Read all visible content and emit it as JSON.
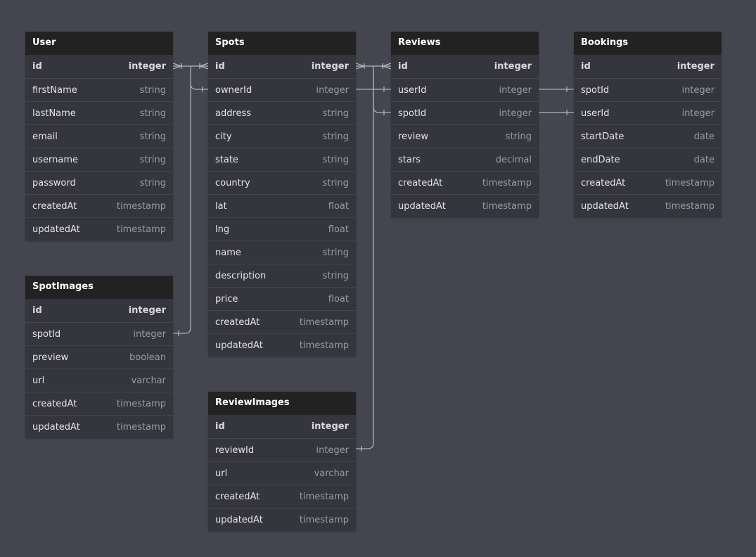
{
  "tables": [
    {
      "name": "User",
      "fields": [
        {
          "name": "id",
          "type": "integer",
          "pk": true
        },
        {
          "name": "firstName",
          "type": "string"
        },
        {
          "name": "lastName",
          "type": "string"
        },
        {
          "name": "email",
          "type": "string"
        },
        {
          "name": "username",
          "type": "string"
        },
        {
          "name": "password",
          "type": "string"
        },
        {
          "name": "createdAt",
          "type": "timestamp"
        },
        {
          "name": "updatedAt",
          "type": "timestamp"
        }
      ]
    },
    {
      "name": "Spots",
      "fields": [
        {
          "name": "id",
          "type": "integer",
          "pk": true
        },
        {
          "name": "ownerId",
          "type": "integer"
        },
        {
          "name": "address",
          "type": "string"
        },
        {
          "name": "city",
          "type": "string"
        },
        {
          "name": "state",
          "type": "string"
        },
        {
          "name": "country",
          "type": "string"
        },
        {
          "name": "lat",
          "type": "float"
        },
        {
          "name": "lng",
          "type": "float"
        },
        {
          "name": "name",
          "type": "string"
        },
        {
          "name": "description",
          "type": "string"
        },
        {
          "name": "price",
          "type": "float"
        },
        {
          "name": "createdAt",
          "type": "timestamp"
        },
        {
          "name": "updatedAt",
          "type": "timestamp"
        }
      ]
    },
    {
      "name": "Reviews",
      "fields": [
        {
          "name": "id",
          "type": "integer",
          "pk": true
        },
        {
          "name": "userId",
          "type": "integer"
        },
        {
          "name": "spotId",
          "type": "integer"
        },
        {
          "name": "review",
          "type": "string"
        },
        {
          "name": "stars",
          "type": "decimal"
        },
        {
          "name": "createdAt",
          "type": "timestamp"
        },
        {
          "name": "updatedAt",
          "type": "timestamp"
        }
      ]
    },
    {
      "name": "Bookings",
      "fields": [
        {
          "name": "id",
          "type": "integer",
          "pk": true
        },
        {
          "name": "spotId",
          "type": "integer"
        },
        {
          "name": "userId",
          "type": "integer"
        },
        {
          "name": "startDate",
          "type": "date"
        },
        {
          "name": "endDate",
          "type": "date"
        },
        {
          "name": "createdAt",
          "type": "timestamp"
        },
        {
          "name": "updatedAt",
          "type": "timestamp"
        }
      ]
    },
    {
      "name": "SpotImages",
      "fields": [
        {
          "name": "id",
          "type": "integer",
          "pk": true
        },
        {
          "name": "spotId",
          "type": "integer"
        },
        {
          "name": "preview",
          "type": "boolean"
        },
        {
          "name": "url",
          "type": "varchar"
        },
        {
          "name": "createdAt",
          "type": "timestamp"
        },
        {
          "name": "updatedAt",
          "type": "timestamp"
        }
      ]
    },
    {
      "name": "ReviewImages",
      "fields": [
        {
          "name": "id",
          "type": "integer",
          "pk": true
        },
        {
          "name": "reviewId",
          "type": "integer"
        },
        {
          "name": "url",
          "type": "varchar"
        },
        {
          "name": "createdAt",
          "type": "timestamp"
        },
        {
          "name": "updatedAt",
          "type": "timestamp"
        }
      ]
    }
  ],
  "relationships": [
    {
      "from": "Spots.ownerId",
      "to": "User.id",
      "type": "many-to-one"
    },
    {
      "from": "SpotImages.spotId",
      "to": "Spots.id",
      "type": "many-to-one"
    },
    {
      "from": "Reviews.userId",
      "to": "Spots.id",
      "type": "many-to-one"
    },
    {
      "from": "Reviews.spotId",
      "to": "Spots.id",
      "type": "many-to-one"
    },
    {
      "from": "ReviewImages.reviewId",
      "to": "Reviews.id",
      "type": "many-to-one"
    },
    {
      "from": "Bookings.spotId",
      "to": "Reviews.userId",
      "type": "one-to-one"
    },
    {
      "from": "Bookings.userId",
      "to": "Reviews.spotId",
      "type": "one-to-one"
    }
  ],
  "colors": {
    "canvas": "#45454f",
    "table_body": "#35353d",
    "table_header": "#222222",
    "row_divider": "#44444c",
    "connector": "#b4b4bc"
  }
}
